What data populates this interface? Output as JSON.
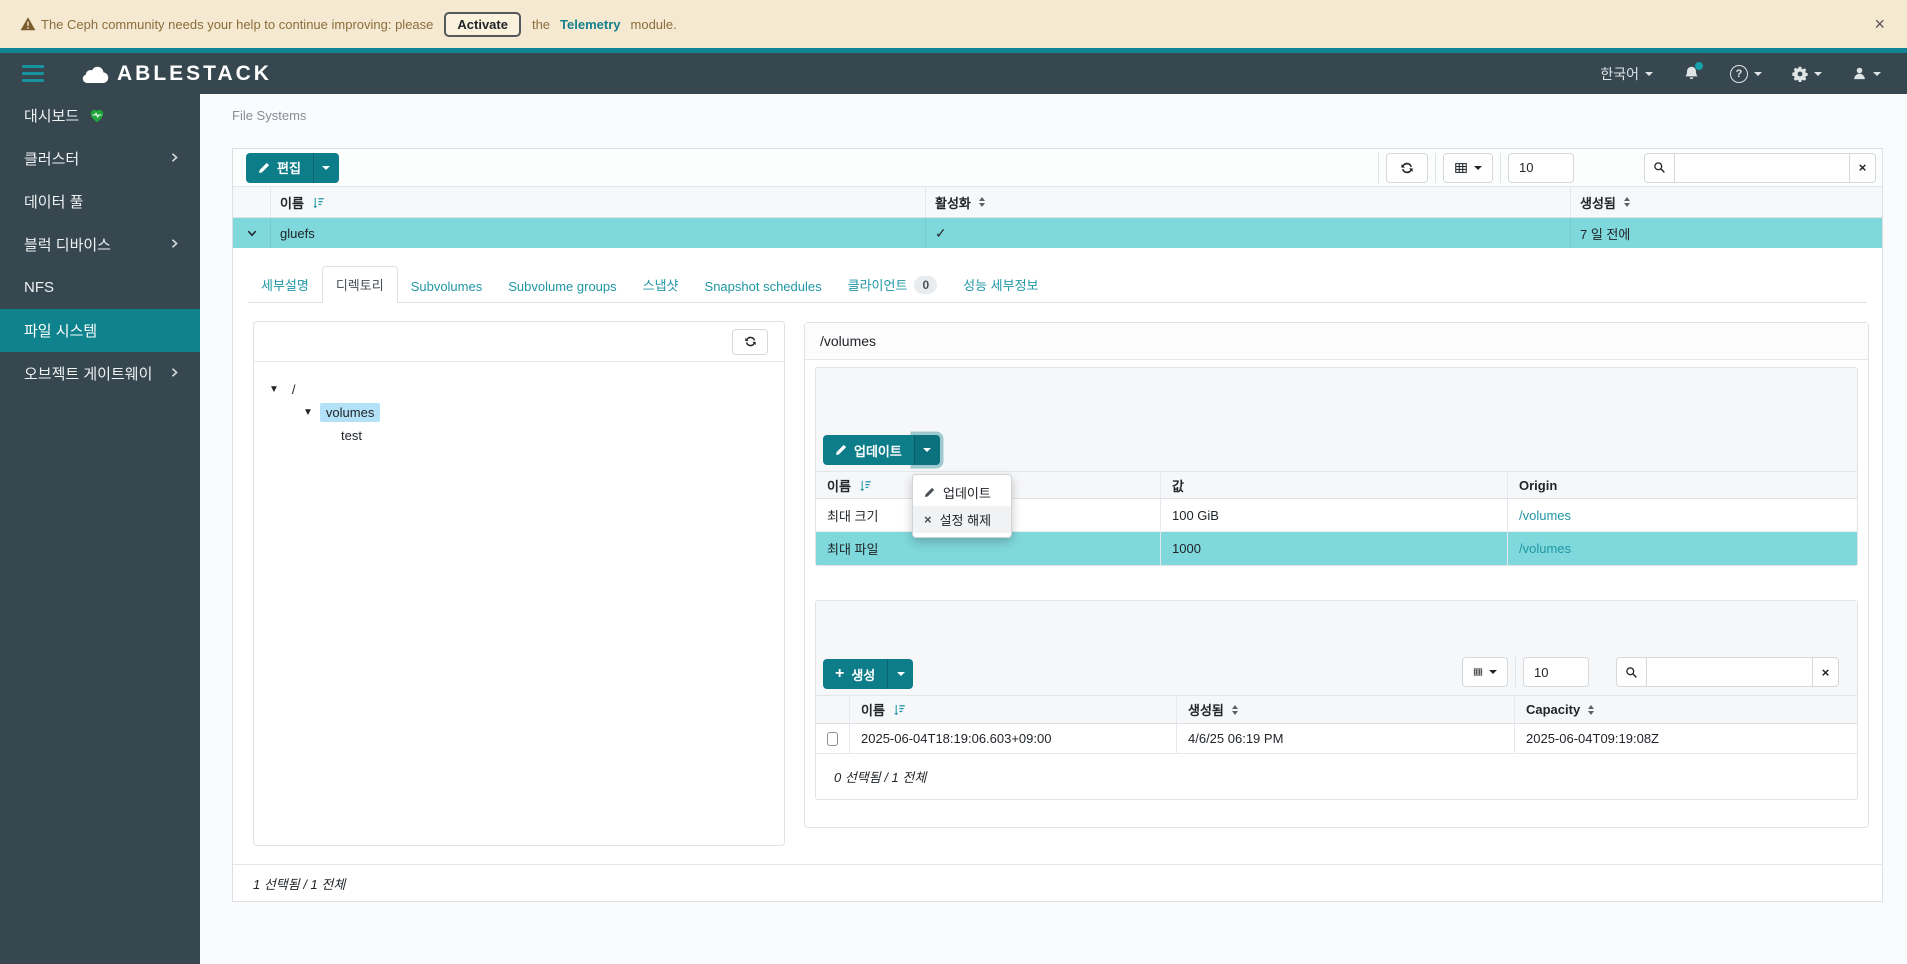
{
  "banner": {
    "text_before": "The Ceph community needs your help to continue improving: please",
    "activate_label": "Activate",
    "text_mid": "the",
    "telemetry_label": "Telemetry",
    "text_after": "module."
  },
  "icons": {
    "close": "×",
    "check": "✓",
    "clear": "×",
    "question": "?",
    "remove": "×",
    "tree_caret": "▼",
    "plus": "+"
  },
  "header": {
    "brand": "ABLESTACK",
    "language": "한국어"
  },
  "sidebar": {
    "items": [
      {
        "label": "대시보드"
      },
      {
        "label": "클러스터"
      },
      {
        "label": "데이터 풀"
      },
      {
        "label": "블럭 디바이스"
      },
      {
        "label": "NFS"
      },
      {
        "label": "파일 시스템"
      },
      {
        "label": "오브젝트 게이트웨이"
      }
    ]
  },
  "page": {
    "breadcrumb": "File Systems"
  },
  "fs": {
    "edit_label": "편집",
    "page_size": "10",
    "search_value": "",
    "col_name": "이름",
    "col_enabled": "활성화",
    "col_created": "생성됨",
    "row": {
      "name": "gluefs",
      "created": "7 일 전에"
    },
    "footer": "1 선택됨 / 1 전체"
  },
  "tabs": {
    "client_badge": "0",
    "items": [
      {
        "label": "세부설명"
      },
      {
        "label": "디렉토리"
      },
      {
        "label": "Subvolumes"
      },
      {
        "label": "Subvolume groups"
      },
      {
        "label": "스냅샷"
      },
      {
        "label": "Snapshot schedules"
      },
      {
        "label": "클라이언트"
      },
      {
        "label": "성능 세부정보"
      }
    ]
  },
  "tree": {
    "items": [
      {
        "label": "/"
      },
      {
        "label": "volumes"
      },
      {
        "label": "test"
      }
    ]
  },
  "detail": {
    "title": "/volumes",
    "update_label": "업데이트",
    "menu": {
      "items": [
        {
          "label": "업데이트"
        },
        {
          "label": "설정 해제"
        }
      ]
    },
    "quota": {
      "col_name": "이름",
      "col_value": "값",
      "col_origin": "Origin",
      "rows": [
        {
          "name": "최대 크기",
          "value": "100 GiB",
          "origin": "/volumes"
        },
        {
          "name": "최대 파일",
          "value": "1000",
          "origin": "/volumes"
        }
      ]
    },
    "snapshots": {
      "create_label": "생성",
      "page_size": "10",
      "search_value": "",
      "col_name": "이름",
      "col_created": "생성됨",
      "col_capacity": "Capacity",
      "row": {
        "name": "2025-06-04T18:19:06.603+09:00",
        "created": "4/6/25 06:19 PM",
        "capacity": "2025-06-04T09:19:08Z"
      },
      "footer": "0 선택됨 / 1 전체"
    }
  },
  "colors": {
    "primary": "#0c7d89",
    "link": "#2097a5",
    "row_selection": "#7fd8dc",
    "tree_selection": "#b3e1f7",
    "sidebar_bg": "#37474f",
    "banner_bg": "#f6e9d2",
    "banner_text": "#8a6d3b",
    "teal_strip": "#108494",
    "health_green": "#1ea63c"
  }
}
